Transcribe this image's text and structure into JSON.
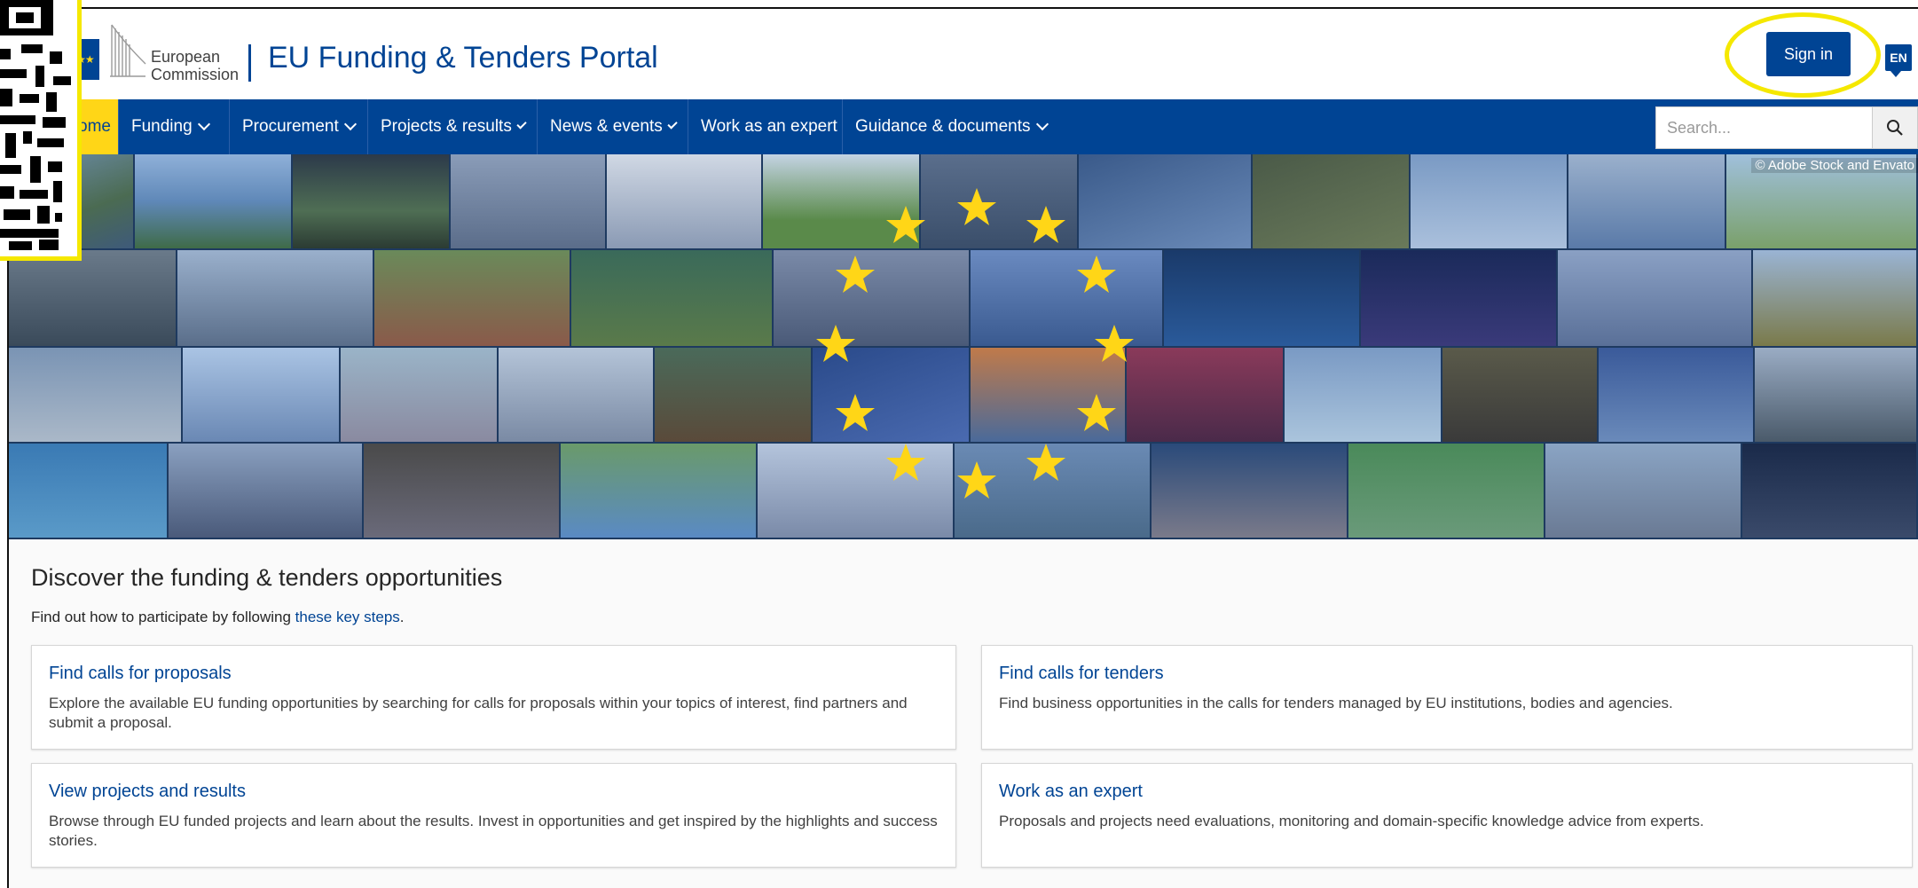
{
  "header": {
    "org_name_line1": "European",
    "org_name_line2": "Commission",
    "portal_title": "EU Funding & Tenders Portal",
    "sign_in_label": "Sign in",
    "language_label": "EN"
  },
  "nav": {
    "items": [
      {
        "label": "ome"
      },
      {
        "label": "Funding"
      },
      {
        "label": "Procurement"
      },
      {
        "label": "Projects & results"
      },
      {
        "label": "News & events"
      },
      {
        "label": "Work as an expert"
      },
      {
        "label": "Guidance & documents"
      }
    ],
    "search_placeholder": "Search..."
  },
  "banner": {
    "credit": "© Adobe Stock and Envato"
  },
  "discover": {
    "title": "Discover the funding & tenders opportunities",
    "subtitle_prefix": "Find out how to participate by following ",
    "subtitle_link": "these key steps",
    "subtitle_suffix": "."
  },
  "cards": [
    {
      "title": "Find calls for proposals",
      "text": "Explore the available EU funding opportunities by searching for calls for proposals within your topics of interest, find partners and submit a proposal."
    },
    {
      "title": "Find calls for tenders",
      "text": "Find business opportunities in the calls for tenders managed by EU institutions, bodies and agencies."
    },
    {
      "title": "View projects and results",
      "text": "Browse through EU funded projects and learn about the results. Invest in opportunities and get inspired by the highlights and success stories."
    },
    {
      "title": "Work as an expert",
      "text": "Proposals and projects need evaluations, monitoring and domain-specific knowledge advice from experts."
    }
  ],
  "colors": {
    "brand_blue": "#004494",
    "eu_yellow": "#ffd617",
    "highlight_yellow": "#f5e800"
  },
  "icons": [
    "eu-flag-icon",
    "ec-building-logo",
    "globe-language-icon",
    "search-icon",
    "chevron-down-icon",
    "qr-code-icon",
    "eu-star-icon"
  ]
}
